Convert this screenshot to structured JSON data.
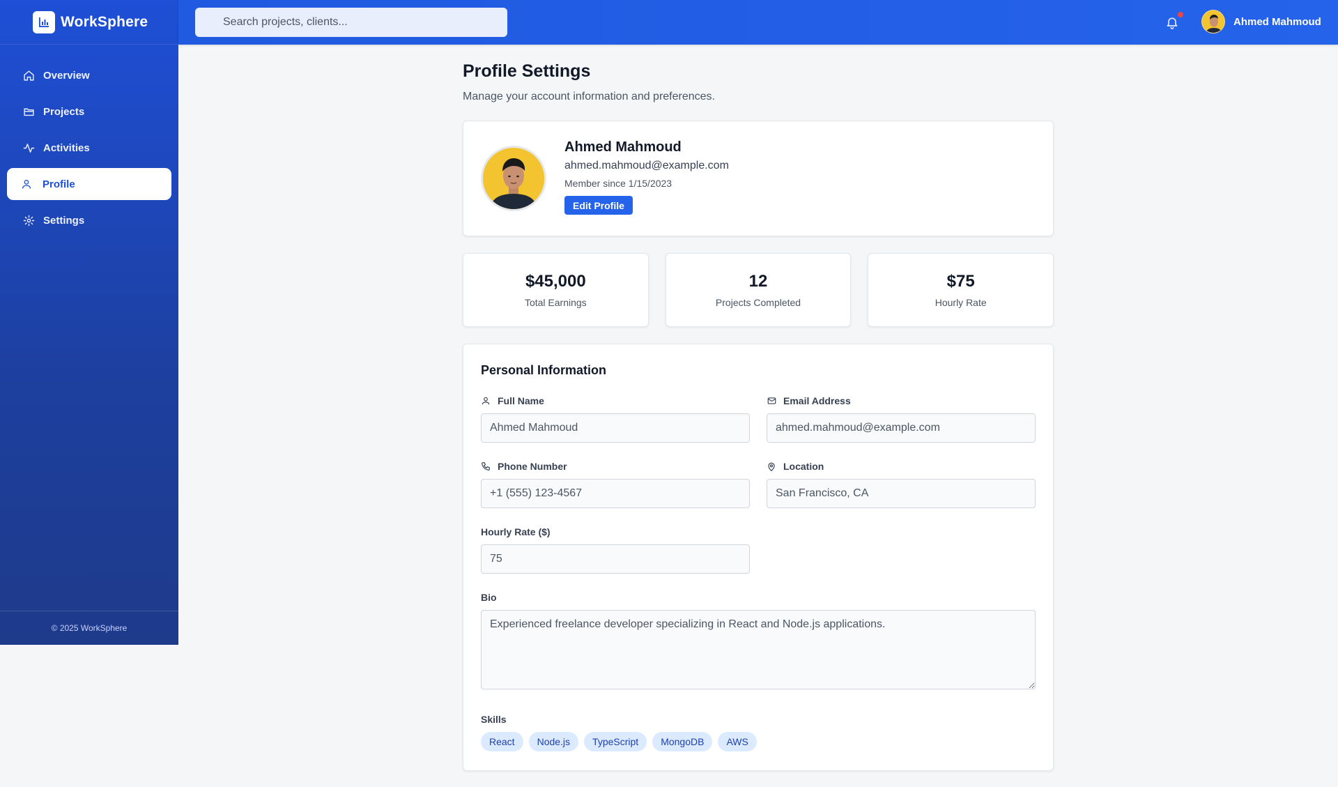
{
  "app": {
    "name": "WorkSphere",
    "footer": "© 2025 WorkSphere"
  },
  "sidebar": {
    "items": [
      {
        "label": "Overview",
        "icon": "home-icon",
        "active": false
      },
      {
        "label": "Projects",
        "icon": "folder-icon",
        "active": false
      },
      {
        "label": "Activities",
        "icon": "activity-icon",
        "active": false
      },
      {
        "label": "Profile",
        "icon": "user-icon",
        "active": true
      },
      {
        "label": "Settings",
        "icon": "gear-icon",
        "active": false
      }
    ]
  },
  "header": {
    "search_placeholder": "Search projects, clients...",
    "user_name": "Ahmed Mahmoud",
    "notification_dot": true
  },
  "page": {
    "title": "Profile Settings",
    "subtitle": "Manage your account information and preferences."
  },
  "profile": {
    "name": "Ahmed Mahmoud",
    "email": "ahmed.mahmoud@example.com",
    "member_since": "Member since 1/15/2023",
    "edit_label": "Edit Profile"
  },
  "stats": [
    {
      "value": "$45,000",
      "label": "Total Earnings"
    },
    {
      "value": "12",
      "label": "Projects Completed"
    },
    {
      "value": "$75",
      "label": "Hourly Rate"
    }
  ],
  "personal": {
    "title": "Personal Information",
    "full_name": {
      "label": "Full Name",
      "value": "Ahmed Mahmoud"
    },
    "email": {
      "label": "Email Address",
      "value": "ahmed.mahmoud@example.com"
    },
    "phone": {
      "label": "Phone Number",
      "value": "+1 (555) 123-4567"
    },
    "location": {
      "label": "Location",
      "value": "San Francisco, CA"
    },
    "hourly_rate": {
      "label": "Hourly Rate ($)",
      "value": "75"
    },
    "bio": {
      "label": "Bio",
      "value": "Experienced freelance developer specializing in React and Node.js applications."
    },
    "skills_label": "Skills",
    "skills": [
      "React",
      "Node.js",
      "TypeScript",
      "MongoDB",
      "AWS"
    ]
  },
  "colors": {
    "primary": "#2563eb",
    "sidebar_dark": "#1e3a8a",
    "notification": "#ef4444",
    "skill_bg": "#dbeafe"
  }
}
